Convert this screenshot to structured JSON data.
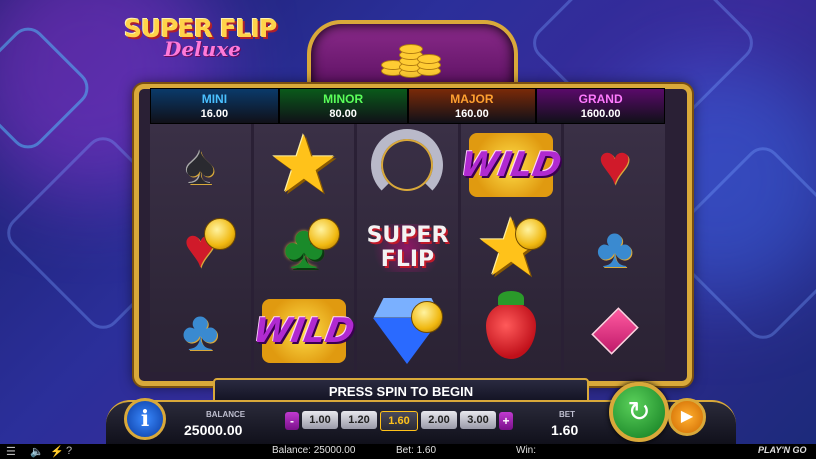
{
  "logo": {
    "line1": "SUPER FLIP",
    "line2": "Deluxe"
  },
  "jackpots": [
    {
      "name": "MINI",
      "value": "16.00",
      "color": "#4ac0ff",
      "bg": "#0a3a6a"
    },
    {
      "name": "MINOR",
      "value": "80.00",
      "color": "#5aff5a",
      "bg": "#0a5a1a"
    },
    {
      "name": "MAJOR",
      "value": "160.00",
      "color": "#ffa030",
      "bg": "#7a2a08"
    },
    {
      "name": "GRAND",
      "value": "1600.00",
      "color": "#ff7aff",
      "bg": "#5a0a6a"
    }
  ],
  "reels": [
    [
      "spade-icon",
      "heart-coin-icon",
      "club-icon"
    ],
    [
      "star-icon",
      "clover-coin-icon",
      "wild-icon"
    ],
    [
      "horseshoe-icon",
      "super-flip-icon",
      "diamond-coin-icon"
    ],
    [
      "wild-icon",
      "star-coin-icon",
      "strawberry-icon"
    ],
    [
      "heart-icon",
      "club-icon",
      "diamond-suit-icon"
    ]
  ],
  "reel_labels": {
    "wild": "WILD",
    "super": "SUPER",
    "flip": "FLIP"
  },
  "message": "PRESS SPIN TO BEGIN",
  "balance": {
    "label": "BALANCE",
    "value": "25000.00"
  },
  "bet": {
    "label": "BET",
    "value": "1.60",
    "options": [
      "1.00",
      "1.20",
      "1.60",
      "2.00",
      "3.00"
    ],
    "selected": "1.60",
    "minus": "-",
    "plus": "+"
  },
  "info_label": "i",
  "status_bar": {
    "balance": "Balance: 25000.00",
    "bet": "Bet: 1.60",
    "win": "Win:",
    "brand": "PLAY'N GO"
  }
}
